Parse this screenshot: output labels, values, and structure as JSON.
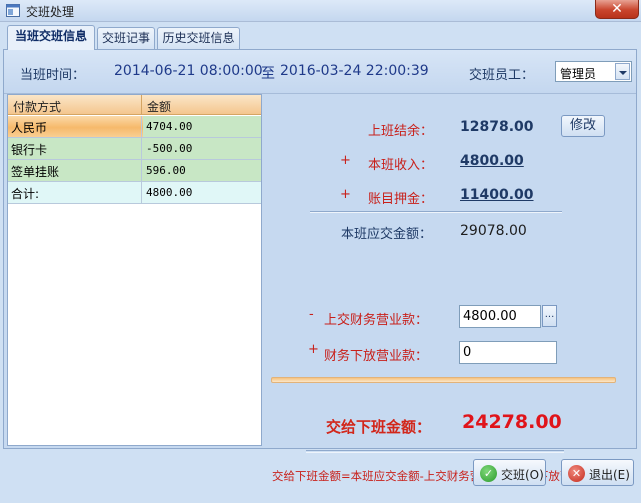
{
  "window": {
    "title": "交班处理",
    "close_icon": "✕"
  },
  "tabs": [
    {
      "label": "当班交班信息"
    },
    {
      "label": "交班记事"
    },
    {
      "label": "历史交班信息"
    }
  ],
  "header": {
    "time_label": "当班时间：",
    "start_time": "2014-06-21  08:00:00",
    "to_text": "至",
    "end_time": "2016-03-24 22:00:39",
    "staff_label": "交班员工：",
    "staff_value": "管理员"
  },
  "grid": {
    "columns": [
      "付款方式",
      "金额"
    ],
    "rows": [
      {
        "method": "人民币",
        "amount": "4704.00"
      },
      {
        "method": "银行卡",
        "amount": "-500.00"
      },
      {
        "method": "签单挂账",
        "amount": "596.00"
      },
      {
        "method": "合计:",
        "amount": "4800.00"
      }
    ]
  },
  "summary": {
    "prev_balance_label": "上班结余：",
    "prev_balance_value": "12878.00",
    "modify_button": "修改",
    "income_sign": "+",
    "income_label": "本班收入：",
    "income_value": "4800.00",
    "deposit_sign": "+",
    "deposit_label": "账目押金：",
    "deposit_value": "11400.00",
    "due_label": "本班应交金额：",
    "due_value": "29078.00",
    "handed_sign": "-",
    "handed_label": "上交财务营业款：",
    "handed_value": "4800.00",
    "dots_button": "...",
    "issued_sign": "+",
    "issued_label": "财务下放营业款：",
    "issued_value": "0",
    "handover_label": "交给下班金额：",
    "handover_value": "24278.00",
    "formula": "交给下班金额=本班应交金额-上交财务营业款+财务下放营业款"
  },
  "footer": {
    "confirm_label": "交班(O)",
    "exit_label": "退出(E)"
  },
  "colors": {
    "accent_red": "#c8201a",
    "navy": "#1f3a66",
    "panel_bg": "#c6d9f0",
    "row_highlight": "#f6b96b",
    "row_green": "#c8e7c5",
    "row_total": "#e0f7f7"
  }
}
